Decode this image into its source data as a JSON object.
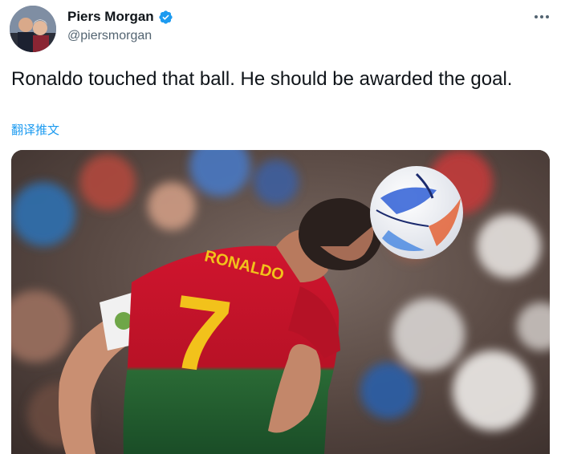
{
  "author": {
    "display_name": "Piers Morgan",
    "handle": "@piersmorgan",
    "verified": true
  },
  "tweet": {
    "text": "Ronaldo touched that ball. He should be awarded the goal.",
    "translate_label": "翻译推文"
  },
  "media": {
    "jersey_name": "RONALDO",
    "jersey_number": "7"
  },
  "icons": {
    "verified": "verified-badge-icon",
    "more": "more-options-icon"
  },
  "colors": {
    "link": "#1d9bf0",
    "secondary_text": "#536471",
    "jersey_red": "#c8102e",
    "jersey_green": "#1f5a2c",
    "number_yellow": "#f2c21b"
  }
}
